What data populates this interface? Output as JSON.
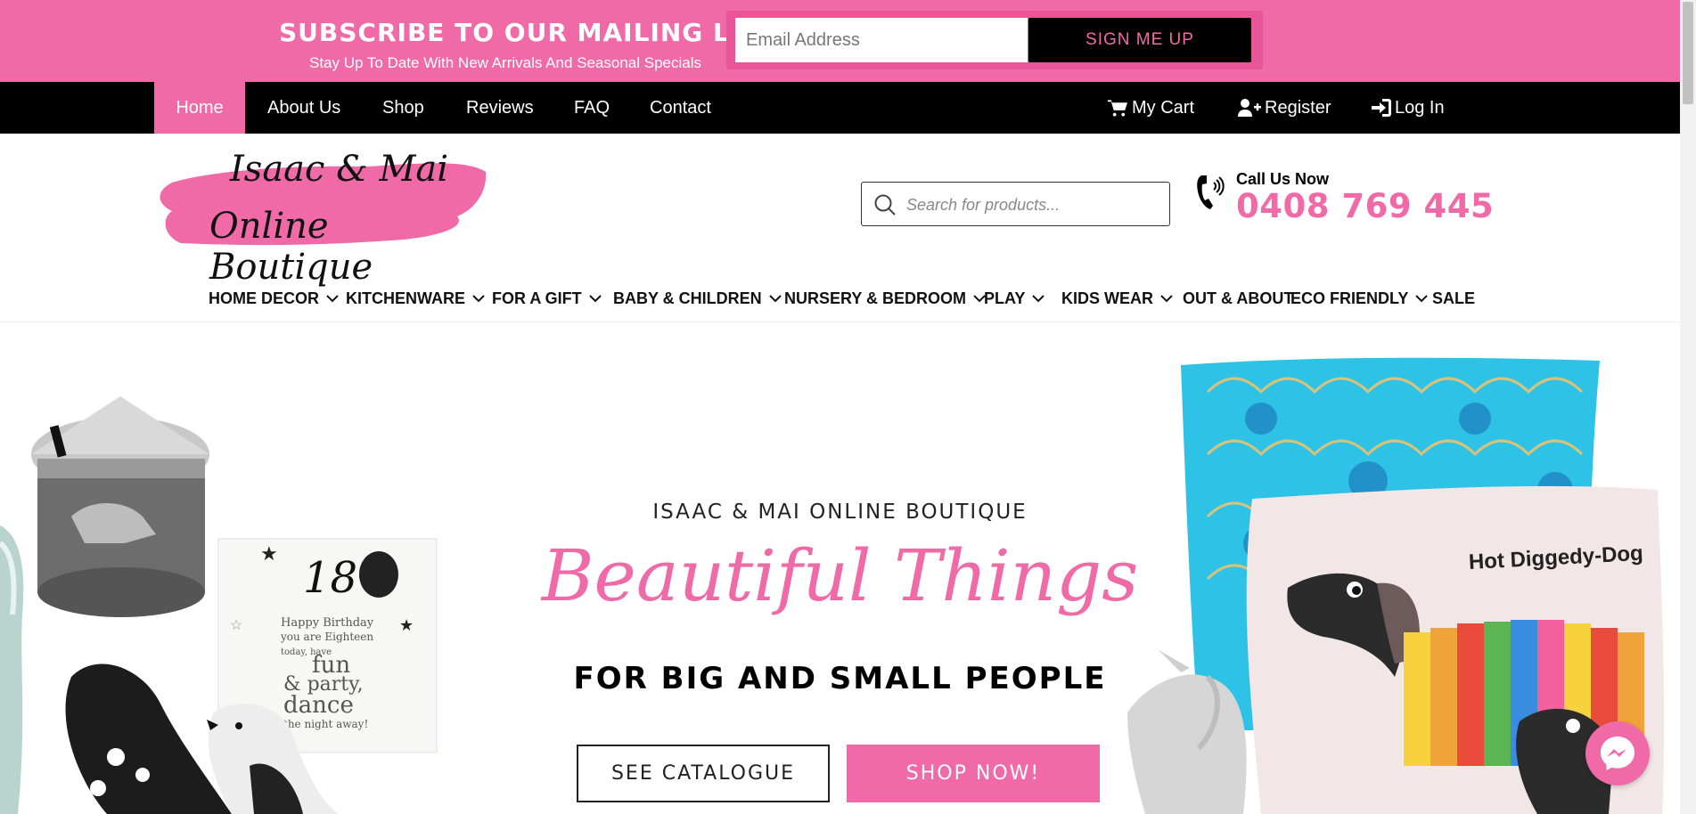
{
  "promo": {
    "title": "SUBSCRIBE TO OUR MAILING LIST",
    "subtitle": "Stay Up To Date With New Arrivals And Seasonal Specials",
    "email_placeholder": "Email Address",
    "button_label": "SIGN ME UP"
  },
  "topnav": {
    "items": [
      {
        "label": "Home",
        "active": true
      },
      {
        "label": "About Us"
      },
      {
        "label": "Shop"
      },
      {
        "label": "Reviews"
      },
      {
        "label": "FAQ"
      },
      {
        "label": "Contact"
      }
    ],
    "right": [
      {
        "label": "My Cart",
        "icon": "cart-icon"
      },
      {
        "label": "Register",
        "icon": "user-plus-icon"
      },
      {
        "label": "Log In",
        "icon": "sign-in-icon"
      }
    ]
  },
  "header": {
    "logo_line1": "Isaac & Mai",
    "logo_line2": "Online Boutique",
    "search_placeholder": "Search for products...",
    "call_label": "Call Us Now",
    "phone": "0408 769 445"
  },
  "categories": [
    {
      "label": "HOME DECOR",
      "dropdown": true
    },
    {
      "label": "KITCHENWARE",
      "dropdown": true
    },
    {
      "label": "FOR A GIFT",
      "dropdown": true
    },
    {
      "label": "BABY & CHILDREN",
      "dropdown": true
    },
    {
      "label": "NURSERY & BEDROOM",
      "dropdown": true
    },
    {
      "label": "PLAY",
      "dropdown": true
    },
    {
      "label": "KIDS WEAR",
      "dropdown": true
    },
    {
      "label": "OUT & ABOUT",
      "dropdown": false
    },
    {
      "label": "ECO FRIENDLY",
      "dropdown": true
    },
    {
      "label": "SALE",
      "dropdown": false
    }
  ],
  "hero": {
    "eyebrow": "ISAAC & MAI ONLINE BOUTIQUE",
    "script": "Beautiful Things",
    "tagline": "FOR BIG AND SMALL PEOPLE",
    "btn_catalogue": "SEE CATALOGUE",
    "btn_shop": "SHOP NOW!",
    "card_18": "18",
    "card_text": [
      "Happy Birthday",
      "you are Eighteen",
      "today, have",
      "fun",
      "& party,",
      "dance",
      "the night away!"
    ],
    "pillow_text": "Hot Diggedy-Dog"
  },
  "colors": {
    "brand_pink": "#f06aa8",
    "black": "#000000"
  }
}
